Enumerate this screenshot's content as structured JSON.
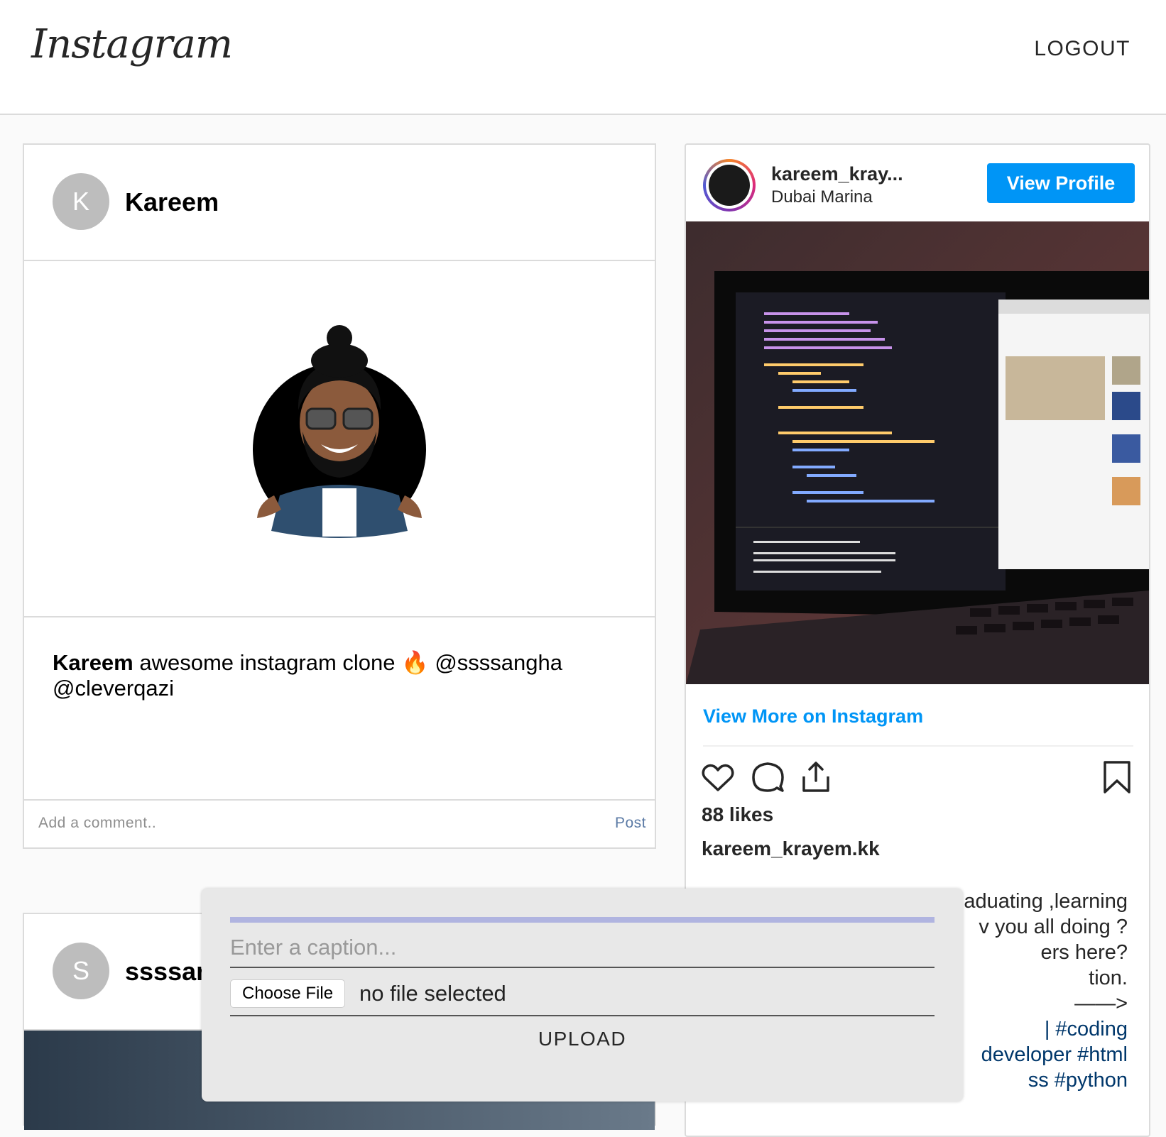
{
  "header": {
    "logo": "Instagram",
    "logout_label": "LOGOUT"
  },
  "posts": [
    {
      "avatar_letter": "K",
      "username": "Kareem",
      "caption_user": "Kareem",
      "caption_text": "awesome instagram clone 🔥 @ssssangha @cleverqazi",
      "comment_placeholder": "Add a comment..",
      "post_label": "Post"
    },
    {
      "avatar_letter": "S",
      "username": "ssssangha"
    }
  ],
  "embed": {
    "username": "kareem_kray...",
    "location": "Dubai Marina",
    "view_profile_label": "View Profile",
    "view_more_label": "View More on Instagram",
    "likes": "88 likes",
    "owner": "kareem_krayem.kk",
    "desc_lines": [
      "aduating ,learning",
      "v you all doing ?",
      "ers here?",
      "tion."
    ],
    "arrow_line": "——>",
    "hashtag_lines": [
      "| #coding",
      "developer #html",
      "ss #python"
    ]
  },
  "modal": {
    "caption_placeholder": "Enter a caption...",
    "choose_file_label": "Choose File",
    "file_status": "no file selected",
    "upload_label": "UPLOAD"
  },
  "colors": {
    "accent": "#0095f6",
    "link": "#00376b",
    "border": "#dbdbdb"
  }
}
